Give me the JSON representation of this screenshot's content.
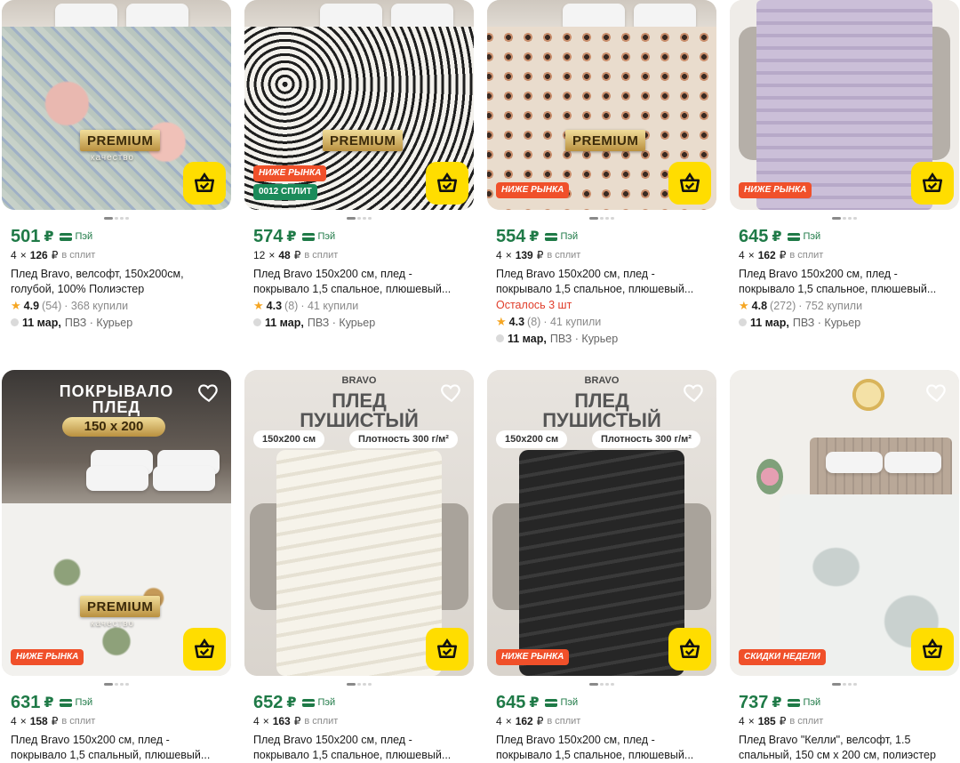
{
  "colors": {
    "accent_yellow": "#ffdd00",
    "price_green": "#1f7a47",
    "badge_red": "#f0502a",
    "badge_green": "#1b8b5a",
    "stock_red": "#e03d2a",
    "star": "#f5a623"
  },
  "labels": {
    "pay": "Пэй",
    "in_split": "в сплит",
    "rub": "₽",
    "mul": "×",
    "star_icon": "★",
    "premium": "PREMIUM",
    "premium_sub": "качество"
  },
  "products": [
    {
      "price": "501",
      "split_count": "4",
      "split_amount": "126",
      "title": "Плед Bravo, велсофт, 150х200см, голубой, 100% Полиэстер",
      "stock": "",
      "rating": "4.9",
      "reviews": "(54)",
      "bought": "· 368 купили",
      "delivery_date": "11 мар,",
      "delivery_methods": "ПВЗ · Курьер",
      "badges": [],
      "image_caption_brand": ""
    },
    {
      "price": "574",
      "split_count": "12",
      "split_amount": "48",
      "title": "Плед Bravo 150х200 см, плед - покрывало 1,5 спальное, плюшевый...",
      "stock": "",
      "rating": "4.3",
      "reviews": "(8)",
      "bought": "· 41 купили",
      "delivery_date": "11 мар,",
      "delivery_methods": "ПВЗ · Курьер",
      "badges": [
        "НИЖЕ РЫНКА",
        "0012 СПЛИТ"
      ]
    },
    {
      "price": "554",
      "split_count": "4",
      "split_amount": "139",
      "title": "Плед Bravo 150х200 см, плед - покрывало 1,5 спальное, плюшевый...",
      "stock": "Осталось 3 шт",
      "rating": "4.3",
      "reviews": "(8)",
      "bought": "· 41 купили",
      "delivery_date": "11 мар,",
      "delivery_methods": "ПВЗ · Курьер",
      "badges": [
        "НИЖЕ РЫНКА"
      ]
    },
    {
      "price": "645",
      "split_count": "4",
      "split_amount": "162",
      "title": "Плед Bravo 150х200 см, плед - покрывало 1,5 спальное, плюшевый...",
      "stock": "",
      "rating": "4.8",
      "reviews": "(272)",
      "bought": "· 752 купили",
      "delivery_date": "11 мар,",
      "delivery_methods": "ПВЗ · Курьер",
      "badges": [
        "НИЖЕ РЫНКА"
      ]
    },
    {
      "price": "631",
      "split_count": "4",
      "split_amount": "158",
      "title": "Плед Bravo 150х200 см, плед - покрывало 1,5 спальный, плюшевый...",
      "badges": [
        "НИЖЕ РЫНКА"
      ],
      "poster_line1": "ПОКРЫВАЛО",
      "poster_line2": "ПЛЕД",
      "poster_size": "150 x 200"
    },
    {
      "price": "652",
      "split_count": "4",
      "split_amount": "163",
      "title": "Плед Bravo 150х200 см, плед - покрывало 1,5 спальное, плюшевый...",
      "badges": [],
      "poster_brand": "BRAVO",
      "poster_line1": "ПЛЕД",
      "poster_line2": "ПУШИСТЫЙ",
      "poster_size": "150x200 см",
      "poster_density": "Плотность 300 г/м²"
    },
    {
      "price": "645",
      "split_count": "4",
      "split_amount": "162",
      "title": "Плед Bravo 150х200 см, плед - покрывало 1,5 спальное, плюшевый...",
      "badges": [
        "НИЖЕ РЫНКА"
      ],
      "poster_brand": "BRAVO",
      "poster_line1": "ПЛЕД",
      "poster_line2": "ПУШИСТЫЙ",
      "poster_size": "150x200 см",
      "poster_density": "Плотность 300 г/м²"
    },
    {
      "price": "737",
      "split_count": "4",
      "split_amount": "185",
      "title": "Плед Bravo \"Келли\", велсофт, 1.5 спальный, 150 см х 200 см, полиэстер",
      "badges": [
        "СКИДКИ НЕДЕЛИ"
      ]
    }
  ]
}
